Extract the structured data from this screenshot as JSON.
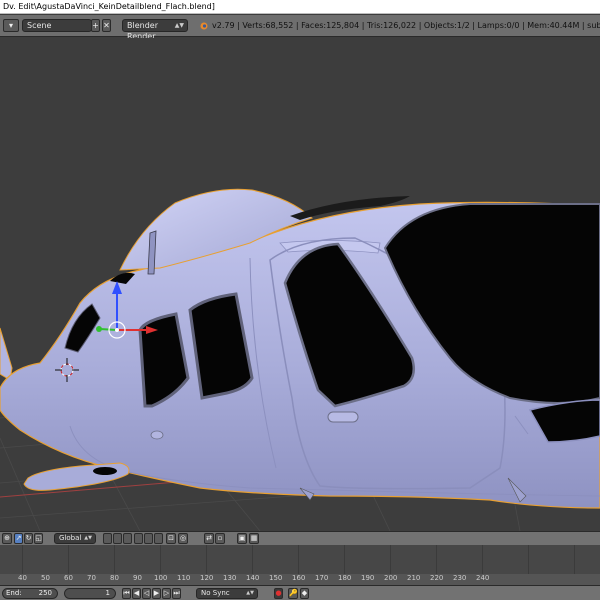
{
  "window": {
    "title": "Dv. Edit\\AgustaDaVinci_KeinDetailblend_Flach.blend]"
  },
  "info_header": {
    "scene": {
      "label": "Scene"
    },
    "render_engine": {
      "label": "Blender Render"
    },
    "stats": "v2.79 | Verts:68,552 | Faces:125,804 | Tris:126,022 | Objects:1/2 | Lamps:0/0 | Mem:40.44M | sub02"
  },
  "viewport_header": {
    "orientation": {
      "label": "Global"
    }
  },
  "timeline": {
    "ruler_ticks": [
      "40",
      "50",
      "60",
      "70",
      "80",
      "90",
      "100",
      "110",
      "120",
      "130",
      "140",
      "150",
      "160",
      "170",
      "180",
      "190",
      "200",
      "210",
      "220",
      "230",
      "240"
    ]
  },
  "timeline_header": {
    "end_field": {
      "label": "End:",
      "value": "250"
    },
    "current_frame": {
      "value": "1"
    },
    "sync_mode": {
      "label": "No Sync"
    }
  },
  "colors": {
    "model_surface": "#a7acd8",
    "selection_outline": "#e8a032",
    "window_glass": "#050505",
    "grid_red_axis": "#b04040",
    "manipulator_x": "#e03030",
    "manipulator_y": "#30c030",
    "manipulator_z": "#3050ff"
  }
}
